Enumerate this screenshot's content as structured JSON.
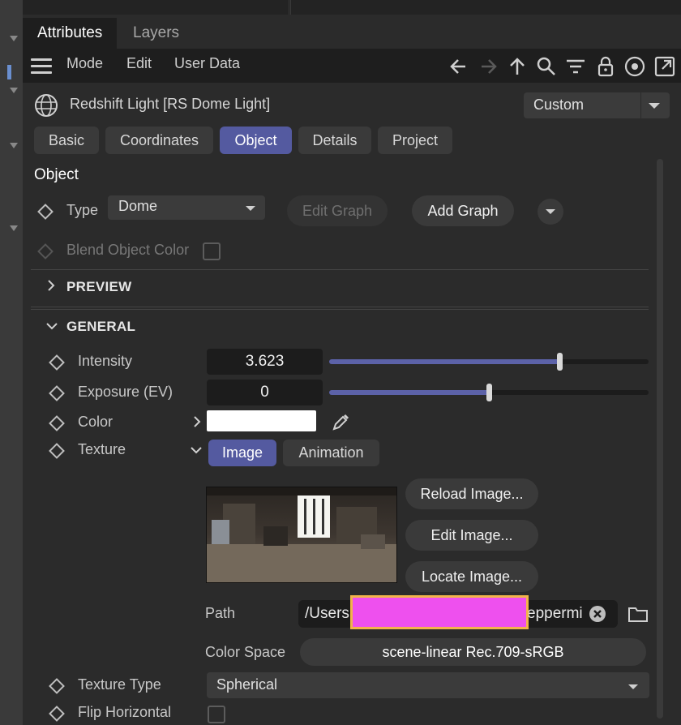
{
  "tabs": {
    "attributes": "Attributes",
    "layers": "Layers"
  },
  "menu": {
    "mode": "Mode",
    "edit": "Edit",
    "user_data": "User Data"
  },
  "object_header": {
    "title": "Redshift Light [RS Dome Light]",
    "preset": "Custom"
  },
  "subtabs": [
    "Basic",
    "Coordinates",
    "Object",
    "Details",
    "Project"
  ],
  "section": {
    "title": "Object"
  },
  "type_row": {
    "label": "Type",
    "value": "Dome",
    "edit_graph": "Edit Graph",
    "add_graph": "Add Graph"
  },
  "blend": {
    "label": "Blend Object Color"
  },
  "groups": {
    "preview": "PREVIEW",
    "general": "GENERAL"
  },
  "intensity": {
    "label": "Intensity",
    "value": "3.623",
    "slider_fraction": 0.72
  },
  "exposure": {
    "label": "Exposure (EV)",
    "value": "0",
    "slider_fraction": 0.5
  },
  "color": {
    "label": "Color",
    "swatch": "#ffffff"
  },
  "texture": {
    "label": "Texture",
    "tab_image": "Image",
    "tab_animation": "Animation",
    "reload": "Reload Image...",
    "edit": "Edit Image...",
    "locate": "Locate Image...",
    "path_label": "Path",
    "path_start": "/Users",
    "path_end": "eppermi",
    "colorspace_label": "Color Space",
    "colorspace_value": "scene-linear Rec.709-sRGB"
  },
  "texture_type": {
    "label": "Texture Type",
    "value": "Spherical"
  },
  "flip": {
    "label": "Flip Horizontal"
  },
  "colors": {
    "accent": "#545aa0",
    "panel": "#2b2b2b",
    "redaction": "#ee50ee"
  }
}
